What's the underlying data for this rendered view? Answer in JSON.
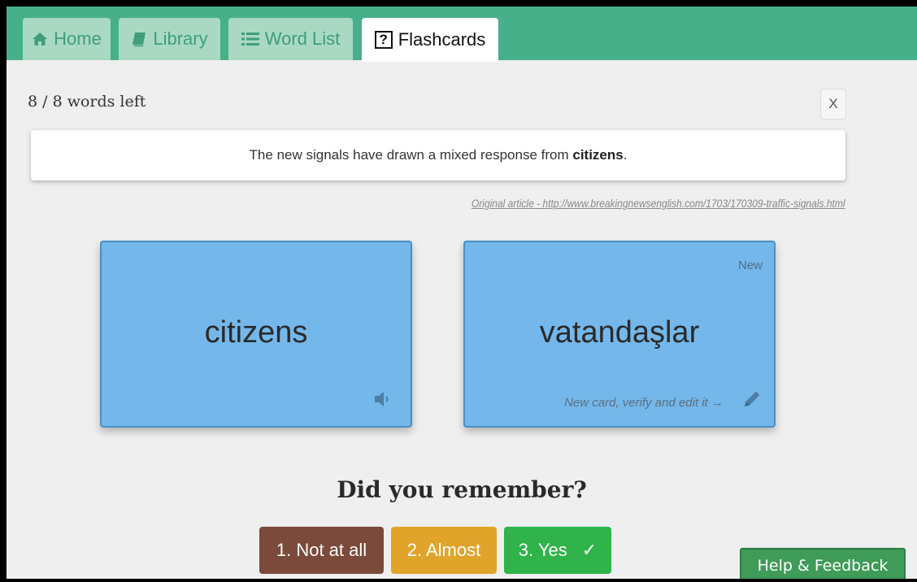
{
  "tabs": [
    {
      "label": "Home",
      "icon": "home-icon",
      "active": false
    },
    {
      "label": "Library",
      "icon": "book-icon",
      "active": false
    },
    {
      "label": "Word List",
      "icon": "list-icon",
      "active": false
    },
    {
      "label": "Flashcards",
      "icon": "question-box-icon",
      "active": true
    }
  ],
  "progress": {
    "text": "8 / 8 words left",
    "remaining": 8,
    "total": 8
  },
  "close_label": "X",
  "sentence": {
    "before": "The new signals have drawn a mixed response from ",
    "highlight": "citizens",
    "after": "."
  },
  "source_link": "Original article - http://www.breakingnewsenglish.com/1703/170309-traffic-signals.html",
  "cards": {
    "front": {
      "word": "citizens",
      "icon": "speaker-icon"
    },
    "back": {
      "word": "vatandaşlar",
      "tag": "New",
      "hint": "New card, verify and edit it →",
      "icon": "pencil-icon"
    }
  },
  "question": "Did you remember?",
  "answers": [
    {
      "label": "1. Not at all",
      "color": "#7b4a3a"
    },
    {
      "label": "2. Almost",
      "color": "#e0a42b"
    },
    {
      "label": "3. Yes",
      "color": "#2fb34a",
      "check": "✓"
    }
  ],
  "help_label": "Help & Feedback",
  "colors": {
    "tabbar": "#46b08a",
    "card": "#74b7ea",
    "background": "#efefef"
  }
}
